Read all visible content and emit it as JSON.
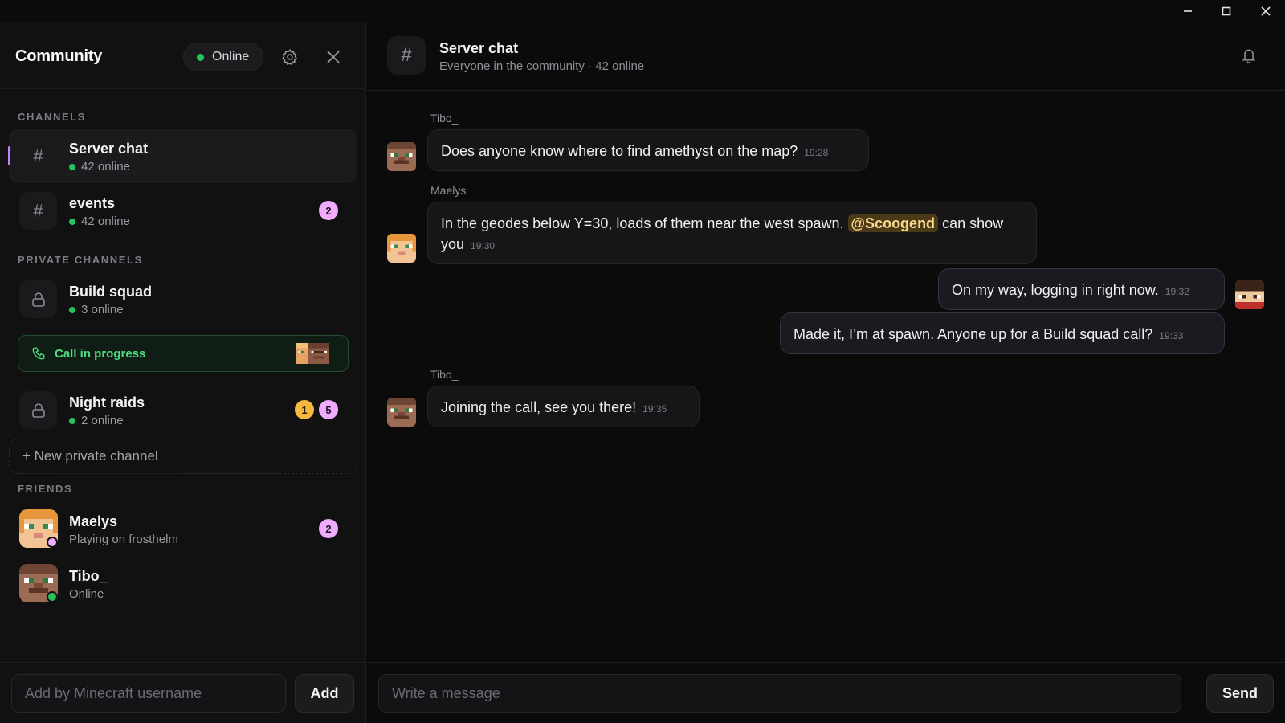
{
  "window": {
    "minimize_icon": "minimize-icon",
    "maximize_icon": "maximize-icon",
    "close_icon": "close-icon"
  },
  "sidebar": {
    "title": "Community",
    "status": "Online",
    "sections": {
      "channels": "CHANNELS",
      "private": "PRIVATE CHANNELS",
      "friends": "FRIENDS"
    },
    "channels": [
      {
        "name": "Server chat",
        "online": "42 online",
        "active": true
      },
      {
        "name": "events",
        "online": "42 online",
        "badge": "2"
      }
    ],
    "private_channels": [
      {
        "name": "Build squad",
        "online": "3 online"
      },
      {
        "name": "Night raids",
        "online": "2 online",
        "badge_gold": "1",
        "badge_pink": "5"
      }
    ],
    "call": {
      "label": "Call in progress"
    },
    "new_channel": "+ New private channel",
    "friends": [
      {
        "name": "Maelys",
        "status": "Playing on frosthelm",
        "badge": "2",
        "presence_color": "#f0abfc"
      },
      {
        "name": "Tibo_",
        "status": "Online",
        "presence_color": "#22c55e"
      }
    ],
    "add_placeholder": "Add by Minecraft username",
    "add_button": "Add"
  },
  "main": {
    "title": "Server chat",
    "subtitle": "Everyone in the community · 42 online",
    "messages": [
      {
        "sender": "Tibo_",
        "text": "Does anyone know where to find amethyst on the map?",
        "time": "19:28"
      },
      {
        "sender": "Maelys",
        "text_before": "In the geodes below Y=30, loads of them near the west spawn. ",
        "mention": "@Scoogend",
        "text_after": " can show you",
        "time": "19:30"
      },
      {
        "text": "On my way, logging in right now.",
        "time": "19:32",
        "mine": true
      },
      {
        "text": "Made it, I’m at spawn. Anyone up for a Build squad call?",
        "time": "19:33",
        "mine": true
      },
      {
        "sender": "Tibo_",
        "text": "Joining the call, see you there!",
        "time": "19:35"
      }
    ],
    "input_placeholder": "Write a message",
    "send_button": "Send"
  },
  "colors": {
    "accent": "#c084fc",
    "online": "#22c55e",
    "call": "#4ade80",
    "mention_bg": "#4a3a18",
    "badge_pink": "#f0abfc",
    "badge_gold": "#f5b942"
  }
}
